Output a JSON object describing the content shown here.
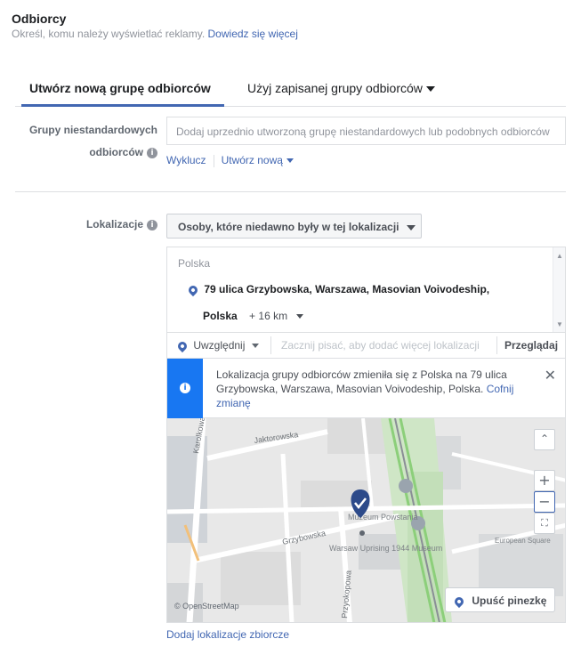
{
  "header": {
    "title": "Odbiorcy",
    "subtitle": "Określ, komu należy wyświetlać reklamy.",
    "learn_more": "Dowiedz się więcej"
  },
  "tabs": [
    {
      "label": "Utwórz nową grupę odbiorców",
      "active": true
    },
    {
      "label": "Użyj zapisanej grupy odbiorców",
      "active": false
    }
  ],
  "custom_audiences": {
    "label_line1": "Grupy niestandardowych",
    "label_line2": "odbiorców",
    "placeholder": "Dodaj uprzednio utworzoną grupę niestandardowych lub podobnych odbiorców",
    "exclude": "Wyklucz",
    "create_new": "Utwórz nową"
  },
  "locations": {
    "label": "Lokalizacje",
    "type_dropdown": "Osoby, które niedawno były w tej lokalizacji",
    "country": "Polska",
    "selected_line1": "79 ulica Grzybowska, Warszawa, Masovian Voivodeship,",
    "selected_line2": "Polska",
    "radius": "+ 16 km",
    "include_label": "Uwzględnij",
    "search_placeholder": "Zacznij pisać, aby dodać więcej lokalizacji",
    "browse": "Przeglądaj",
    "notice_text": "Lokalizacja grupy odbiorców zmieniła się z Polska na 79 ulica Grzybowska, Warszawa, Masovian Voivodeship, Polska.",
    "notice_undo": "Cofnij zmianę",
    "bulk_link": "Dodaj lokalizacje zbiorcze"
  },
  "map": {
    "streets": [
      "Jaktorowska",
      "Karolkowa",
      "Grzybowska",
      "Przyokopowa"
    ],
    "poi_labels": [
      "Muzeum Powstania",
      "Warsaw Uprising 1944 Museum",
      "European Square"
    ],
    "attribution": "© OpenStreetMap",
    "zoom_in": "+",
    "zoom_out": "−",
    "drop_pin": "Upuść pinezkę"
  },
  "colors": {
    "accent": "#4267b2",
    "notice": "#1877f2",
    "pin": "#2c4a8a"
  }
}
